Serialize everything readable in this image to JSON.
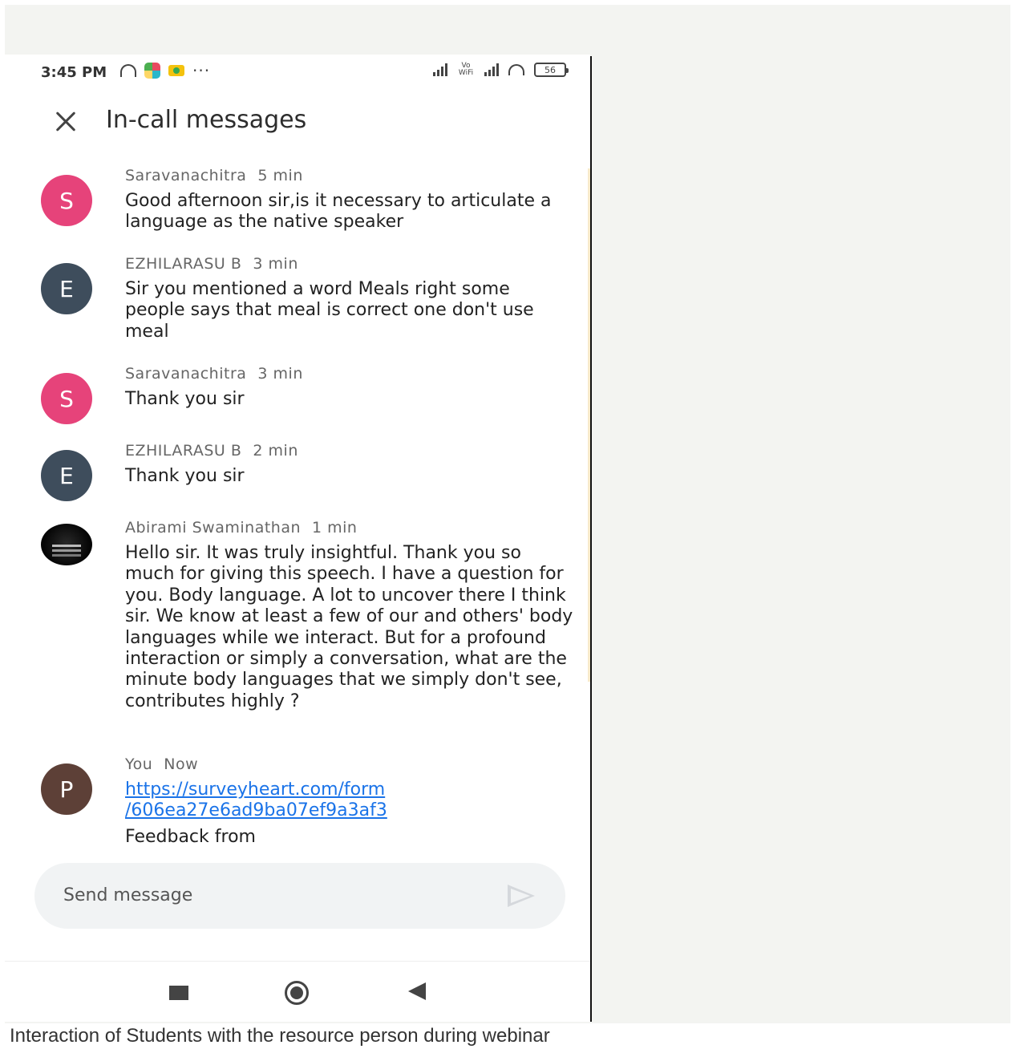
{
  "status_bar": {
    "time": "3:45 PM",
    "battery": "56",
    "wifi_label": "Vo WiFi"
  },
  "header": {
    "title": "In-call messages"
  },
  "messages": [
    {
      "avatar": "S",
      "avatar_color": "#e6437a",
      "sender": "Saravanachitra",
      "time": "5 min",
      "text": "Good afternoon sir,is it necessary to articulate a language as the native speaker"
    },
    {
      "avatar": "E",
      "avatar_color": "#3e4d5c",
      "sender": "EZHILARASU B",
      "time": "3 min",
      "text": "Sir you mentioned a word Meals right some people says that meal is correct one don't use meal"
    },
    {
      "avatar": "S",
      "avatar_color": "#e6437a",
      "sender": "Saravanachitra",
      "time": "3 min",
      "text": "Thank you sir"
    },
    {
      "avatar": "E",
      "avatar_color": "#3e4d5c",
      "sender": "EZHILARASU B",
      "time": "2 min",
      "text": "Thank you sir"
    },
    {
      "avatar": "",
      "avatar_color": "#000000",
      "sender": "Abirami Swaminathan",
      "time": "1 min",
      "text": "Hello sir. It was truly insightful. Thank you so much for giving this speech. I have a question for you. Body language. A lot to uncover there I think sir. We know at least a few of our and others' body languages while we interact. But for a profound interaction or simply a conversation,  what are the minute body languages that we simply don't see, contributes highly ?"
    },
    {
      "avatar": "P",
      "avatar_color": "#5d4037",
      "sender": "You",
      "time": "Now",
      "link_line1": "https://surveyheart.com/form",
      "link_line2": "/606ea27e6ad9ba07ef9a3af3",
      "text": "Feedback from"
    }
  ],
  "composer": {
    "placeholder": "Send message"
  },
  "caption": "Interaction of Students with the resource person during webinar"
}
